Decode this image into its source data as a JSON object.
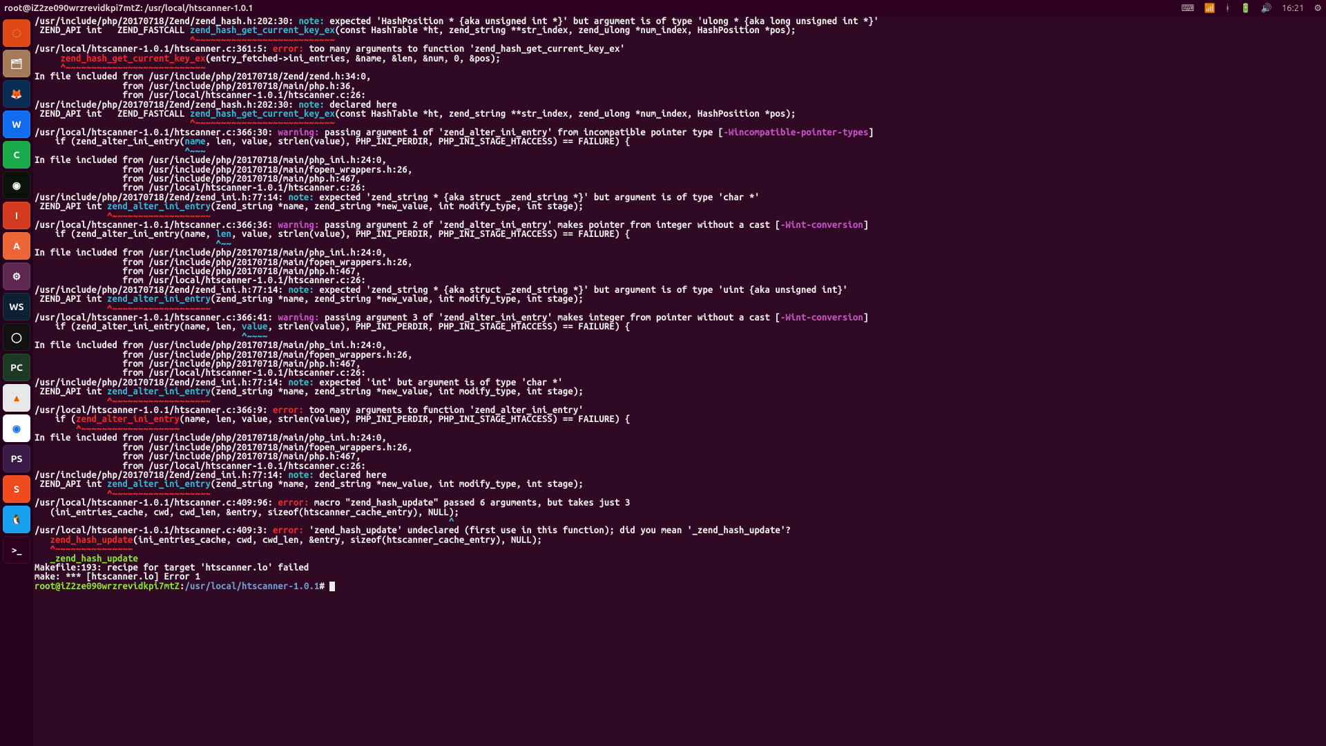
{
  "menubar": {
    "title": "root@iZ2ze090wrzrevidkpi7mtZ: /usr/local/htscanner-1.0.1",
    "time": "16:21"
  },
  "launcher": [
    {
      "name": "dash",
      "bg": "#dd4814",
      "glyph": "◌"
    },
    {
      "name": "files",
      "bg": "#a47b5a",
      "glyph": "🗂"
    },
    {
      "name": "firefox",
      "bg": "#0a2b52",
      "glyph": "🦊"
    },
    {
      "name": "writer",
      "bg": "#106df0",
      "glyph": "W"
    },
    {
      "name": "calc",
      "bg": "#1aa948",
      "glyph": "C"
    },
    {
      "name": "nvidia",
      "bg": "#0a120a",
      "glyph": "◉"
    },
    {
      "name": "impress",
      "bg": "#d23b1f",
      "glyph": "I"
    },
    {
      "name": "software",
      "bg": "#eb6536",
      "glyph": "A"
    },
    {
      "name": "settings",
      "bg": "#5e2750",
      "glyph": "⚙"
    },
    {
      "name": "webstorm",
      "bg": "#0c2234",
      "glyph": "WS"
    },
    {
      "name": "obs",
      "bg": "#111111",
      "glyph": "◯"
    },
    {
      "name": "pycharm",
      "bg": "#1d3b24",
      "glyph": "PC"
    },
    {
      "name": "vlc",
      "bg": "#e8e8e8",
      "glyph": "▲"
    },
    {
      "name": "chrome",
      "bg": "#ffffff",
      "glyph": "◉"
    },
    {
      "name": "phpstorm",
      "bg": "#3a1a47",
      "glyph": "PS"
    },
    {
      "name": "sogou",
      "bg": "#f04b1f",
      "glyph": "S"
    },
    {
      "name": "qq",
      "bg": "#19a0ee",
      "glyph": "🐧"
    },
    {
      "name": "terminal",
      "bg": "#2c001e",
      "glyph": ">_"
    }
  ],
  "indicators": {
    "keyboard": "⌨",
    "wifi": "📶",
    "bt": "ᚼ",
    "battery": "🔋",
    "volume": "🔊",
    "gear": "⚙"
  },
  "prompt": {
    "user": "root@iZ2ze090wrzrevidkpi7mtZ",
    "path": "/usr/local/htscanner-1.0.1",
    "suffix": "#"
  },
  "lines": [
    {
      "t": "locnote",
      "loc": "/usr/include/php/20170718/Zend/zend_hash.h:202:30:",
      "label": "note:",
      "rest": " expected '",
      "q": "HashPosition * {aka unsigned int *}",
      "rest2": "' but argument is of type '",
      "q2": "ulong * {aka long unsigned int *}",
      "rest3": "'"
    },
    {
      "t": "sig",
      "pre": " ZEND_API int   ZEND_FASTCALL ",
      "fn": "zend_hash_get_current_key_ex",
      "post": "(const HashTable *ht, zend_string **str_index, zend_ulong *num_index, HashPosition *pos);"
    },
    {
      "t": "uline",
      "txt": "                              ^~~~~~~~~~~~~~~~~~~~~~~~~~~~"
    },
    {
      "t": "locerr",
      "loc": "/usr/local/htscanner-1.0.1/htscanner.c:361:5:",
      "label": "error:",
      "rest": " too many arguments to function '",
      "q": "zend_hash_get_current_key_ex",
      "rest2": "'"
    },
    {
      "t": "call",
      "pre": "     ",
      "fn": "zend_hash_get_current_key_ex",
      "post": "(entry_fetched->ini_entries, &name, &len, &num, 0, &pos);"
    },
    {
      "t": "uline",
      "txt": "     ^~~~~~~~~~~~~~~~~~~~~~~~~~~~"
    },
    {
      "t": "plain",
      "txt": "In file included from "
    },
    {
      "t": "inc",
      "txt": "/usr/include/php/20170718/Zend/zend.h:34:0,"
    },
    {
      "t": "from",
      "txt": "/usr/include/php/20170718/main/php.h:36,"
    },
    {
      "t": "from",
      "txt": "/usr/local/htscanner-1.0.1/htscanner.c:26:"
    },
    {
      "t": "locnote",
      "loc": "/usr/include/php/20170718/Zend/zend_hash.h:202:30:",
      "label": "note:",
      "rest": " declared here"
    },
    {
      "t": "sig",
      "pre": " ZEND_API int   ZEND_FASTCALL ",
      "fn": "zend_hash_get_current_key_ex",
      "post": "(const HashTable *ht, zend_string **str_index, zend_ulong *num_index, HashPosition *pos);"
    },
    {
      "t": "uline",
      "txt": "                              ^~~~~~~~~~~~~~~~~~~~~~~~~~~~"
    },
    {
      "t": "locwarn",
      "loc": "/usr/local/htscanner-1.0.1/htscanner.c:366:30:",
      "label": "warning:",
      "rest": " passing argument 1 of '",
      "q": "zend_alter_ini_entry",
      "rest2": "' from incompatible pointer type [",
      "flag": "-Wincompatible-pointer-types",
      "rest3": "]"
    },
    {
      "t": "code",
      "pre": "    if (zend_alter_ini_entry(",
      "hl": "name",
      "post": ", len, value, strlen(value), PHP_INI_PERDIR, PHP_INI_STAGE_HTACCESS) == FAILURE) {"
    },
    {
      "t": "ulcyan",
      "txt": "                             ^~~~"
    },
    {
      "t": "plain",
      "txt": "In file included from "
    },
    {
      "t": "inc",
      "txt": "/usr/include/php/20170718/main/php_ini.h:24:0,"
    },
    {
      "t": "from",
      "txt": "/usr/include/php/20170718/main/fopen_wrappers.h:26,"
    },
    {
      "t": "from",
      "txt": "/usr/include/php/20170718/main/php.h:467,"
    },
    {
      "t": "from",
      "txt": "/usr/local/htscanner-1.0.1/htscanner.c:26:"
    },
    {
      "t": "locnote",
      "loc": "/usr/include/php/20170718/Zend/zend_ini.h:77:14:",
      "label": "note:",
      "rest": " expected '",
      "q": "zend_string * {aka struct _zend_string *}",
      "rest2": "' but argument is of type '",
      "q2": "char *",
      "rest3": "'"
    },
    {
      "t": "sig",
      "pre": " ZEND_API int ",
      "fn": "zend_alter_ini_entry",
      "post": "(zend_string *name, zend_string *new_value, int modify_type, int stage);"
    },
    {
      "t": "uline",
      "txt": "              ^~~~~~~~~~~~~~~~~~~~"
    },
    {
      "t": "locwarn",
      "loc": "/usr/local/htscanner-1.0.1/htscanner.c:366:36:",
      "label": "warning:",
      "rest": " passing argument 2 of '",
      "q": "zend_alter_ini_entry",
      "rest2": "' makes pointer from integer without a cast [",
      "flag": "-Wint-conversion",
      "rest3": "]"
    },
    {
      "t": "code",
      "pre": "    if (zend_alter_ini_entry(name, ",
      "hl": "len",
      "post": ", value, strlen(value), PHP_INI_PERDIR, PHP_INI_STAGE_HTACCESS) == FAILURE) {"
    },
    {
      "t": "ulcyan",
      "txt": "                                   ^~~"
    },
    {
      "t": "plain",
      "txt": "In file included from "
    },
    {
      "t": "inc",
      "txt": "/usr/include/php/20170718/main/php_ini.h:24:0,"
    },
    {
      "t": "from",
      "txt": "/usr/include/php/20170718/main/fopen_wrappers.h:26,"
    },
    {
      "t": "from",
      "txt": "/usr/include/php/20170718/main/php.h:467,"
    },
    {
      "t": "from",
      "txt": "/usr/local/htscanner-1.0.1/htscanner.c:26:"
    },
    {
      "t": "locnote",
      "loc": "/usr/include/php/20170718/Zend/zend_ini.h:77:14:",
      "label": "note:",
      "rest": " expected '",
      "q": "zend_string * {aka struct _zend_string *}",
      "rest2": "' but argument is of type '",
      "q2": "uint {aka unsigned int}",
      "rest3": "'"
    },
    {
      "t": "sig",
      "pre": " ZEND_API int ",
      "fn": "zend_alter_ini_entry",
      "post": "(zend_string *name, zend_string *new_value, int modify_type, int stage);"
    },
    {
      "t": "uline",
      "txt": "              ^~~~~~~~~~~~~~~~~~~~"
    },
    {
      "t": "locwarn",
      "loc": "/usr/local/htscanner-1.0.1/htscanner.c:366:41:",
      "label": "warning:",
      "rest": " passing argument 3 of '",
      "q": "zend_alter_ini_entry",
      "rest2": "' makes integer from pointer without a cast [",
      "flag": "-Wint-conversion",
      "rest3": "]"
    },
    {
      "t": "code",
      "pre": "    if (zend_alter_ini_entry(name, len, ",
      "hl": "value",
      "post": ", strlen(value), PHP_INI_PERDIR, PHP_INI_STAGE_HTACCESS) == FAILURE) {"
    },
    {
      "t": "ulcyan",
      "txt": "                                        ^~~~~"
    },
    {
      "t": "plain",
      "txt": "In file included from "
    },
    {
      "t": "inc",
      "txt": "/usr/include/php/20170718/main/php_ini.h:24:0,"
    },
    {
      "t": "from",
      "txt": "/usr/include/php/20170718/main/fopen_wrappers.h:26,"
    },
    {
      "t": "from",
      "txt": "/usr/include/php/20170718/main/php.h:467,"
    },
    {
      "t": "from",
      "txt": "/usr/local/htscanner-1.0.1/htscanner.c:26:"
    },
    {
      "t": "locnote",
      "loc": "/usr/include/php/20170718/Zend/zend_ini.h:77:14:",
      "label": "note:",
      "rest": " expected '",
      "q": "int",
      "rest2": "' but argument is of type '",
      "q2": "char *",
      "rest3": "'"
    },
    {
      "t": "sig",
      "pre": " ZEND_API int ",
      "fn": "zend_alter_ini_entry",
      "post": "(zend_string *name, zend_string *new_value, int modify_type, int stage);"
    },
    {
      "t": "uline",
      "txt": "              ^~~~~~~~~~~~~~~~~~~~"
    },
    {
      "t": "locerr",
      "loc": "/usr/local/htscanner-1.0.1/htscanner.c:366:9:",
      "label": "error:",
      "rest": " too many arguments to function '",
      "q": "zend_alter_ini_entry",
      "rest2": "'"
    },
    {
      "t": "call",
      "pre": "    if (",
      "fn": "zend_alter_ini_entry",
      "post": "(name, len, value, strlen(value), PHP_INI_PERDIR, PHP_INI_STAGE_HTACCESS) == FAILURE) {"
    },
    {
      "t": "uline",
      "txt": "        ^~~~~~~~~~~~~~~~~~~~"
    },
    {
      "t": "plain",
      "txt": "In file included from "
    },
    {
      "t": "inc",
      "txt": "/usr/include/php/20170718/main/php_ini.h:24:0,"
    },
    {
      "t": "from",
      "txt": "/usr/include/php/20170718/main/fopen_wrappers.h:26,"
    },
    {
      "t": "from",
      "txt": "/usr/include/php/20170718/main/php.h:467,"
    },
    {
      "t": "from",
      "txt": "/usr/local/htscanner-1.0.1/htscanner.c:26:"
    },
    {
      "t": "locnote",
      "loc": "/usr/include/php/20170718/Zend/zend_ini.h:77:14:",
      "label": "note:",
      "rest": " declared here"
    },
    {
      "t": "sig",
      "pre": " ZEND_API int ",
      "fn": "zend_alter_ini_entry",
      "post": "(zend_string *name, zend_string *new_value, int modify_type, int stage);"
    },
    {
      "t": "uline",
      "txt": "              ^~~~~~~~~~~~~~~~~~~~"
    },
    {
      "t": "locerr",
      "loc": "/usr/local/htscanner-1.0.1/htscanner.c:409:96:",
      "label": "error:",
      "rest": " macro \"zend_hash_update\" passed 6 arguments, but takes just 3"
    },
    {
      "t": "plainmono",
      "txt": "   (ini_entries_cache, cwd, cwd_len, &entry, sizeof(htscanner_cache_entry), NULL);"
    },
    {
      "t": "ulcyan",
      "txt": "                                                                                ^"
    },
    {
      "t": "locerr",
      "loc": "/usr/local/htscanner-1.0.1/htscanner.c:409:3:",
      "label": "error:",
      "rest": " '",
      "q": "zend_hash_update",
      "rest2": "' undeclared (first use in this function); did you mean '",
      "q2": "_zend_hash_update",
      "rest3": "'?"
    },
    {
      "t": "call",
      "pre": "   ",
      "fn": "zend_hash_update",
      "post": "(ini_entries_cache, cwd, cwd_len, &entry, sizeof(htscanner_cache_entry), NULL);"
    },
    {
      "t": "uline",
      "txt": "   ^~~~~~~~~~~~~~~~"
    },
    {
      "t": "green",
      "txt": "   _zend_hash_update"
    },
    {
      "t": "plainmono",
      "txt": "Makefile:193: recipe for target 'htscanner.lo' failed"
    },
    {
      "t": "plainmono",
      "txt": "make: *** [htscanner.lo] Error 1"
    },
    {
      "t": "prompt"
    }
  ]
}
